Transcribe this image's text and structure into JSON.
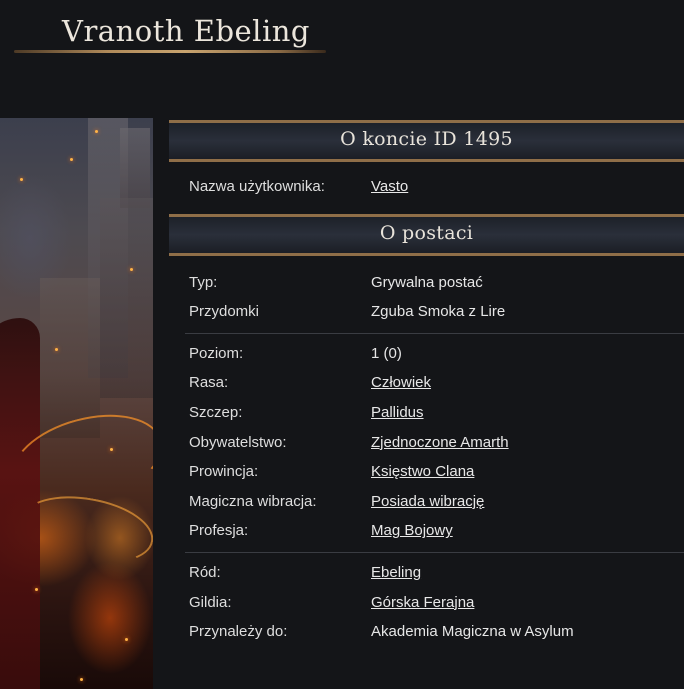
{
  "character_name": "Vranoth Ebeling",
  "account_section": {
    "title": "O koncie ID 1495",
    "rows": [
      {
        "label": "Nazwa użytkownika:",
        "value": "Vasto"
      }
    ]
  },
  "character_section": {
    "title": "O postaci",
    "group1": [
      {
        "label": "Typ:",
        "value": "Grywalna postać"
      },
      {
        "label": "Przydomki",
        "value": "Zguba Smoka z Lire"
      }
    ],
    "group2": [
      {
        "label": "Poziom:",
        "value": "1 (0)"
      },
      {
        "label": "Rasa:",
        "value": "Człowiek"
      },
      {
        "label": "Szczep:",
        "value": "Pallidus"
      },
      {
        "label": "Obywatelstwo:",
        "value": "Zjednoczone Amarth"
      },
      {
        "label": "Prowincja:",
        "value": "Księstwo Clana"
      },
      {
        "label": "Magiczna wibracja:",
        "value": "Posiada wibrację"
      },
      {
        "label": "Profesja:",
        "value": "Mag Bojowy"
      }
    ],
    "group3": [
      {
        "label": "Ród:",
        "value": "Ebeling"
      },
      {
        "label": "Gildia:",
        "value": "Górska Ferajna"
      },
      {
        "label": "Przynależy do:",
        "value": "Akademia Magiczna w Asylum"
      }
    ]
  },
  "colors": {
    "background": "#141518",
    "accent_gold": "#8f6e48",
    "header_bg": "#2a2f3a",
    "text": "#e6e6e6"
  }
}
